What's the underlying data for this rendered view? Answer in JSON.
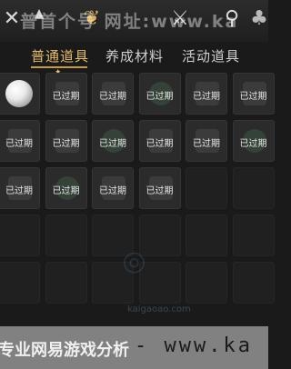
{
  "header": {
    "icons": [
      "close-icon",
      "dice-icon",
      "bag-icon",
      "sword-icon",
      "map-pin-icon",
      "tree-icon"
    ],
    "watermark": "普首个号 网址:www.ka"
  },
  "tabs": [
    {
      "label": "普通道具",
      "active": true
    },
    {
      "label": "养成材料",
      "active": false
    },
    {
      "label": "活动道具",
      "active": false
    }
  ],
  "inventory": {
    "expired_label": "已过期",
    "rows": [
      [
        "ball",
        "expired",
        "expired",
        "expired",
        "expired",
        "expired"
      ],
      [
        "expired",
        "expired",
        "expired",
        "expired",
        "expired",
        "expired"
      ],
      [
        "expired",
        "expired",
        "expired",
        "expired",
        "empty",
        "empty"
      ],
      [
        "empty",
        "empty",
        "empty",
        "empty",
        "empty",
        "empty"
      ],
      [
        "empty",
        "empty",
        "empty",
        "empty",
        "empty",
        "empty"
      ]
    ]
  },
  "watermark_bottom": {
    "text": "专业网易游戏分析",
    "url": "- www.ka",
    "url_small": "kaigaoao.com"
  }
}
